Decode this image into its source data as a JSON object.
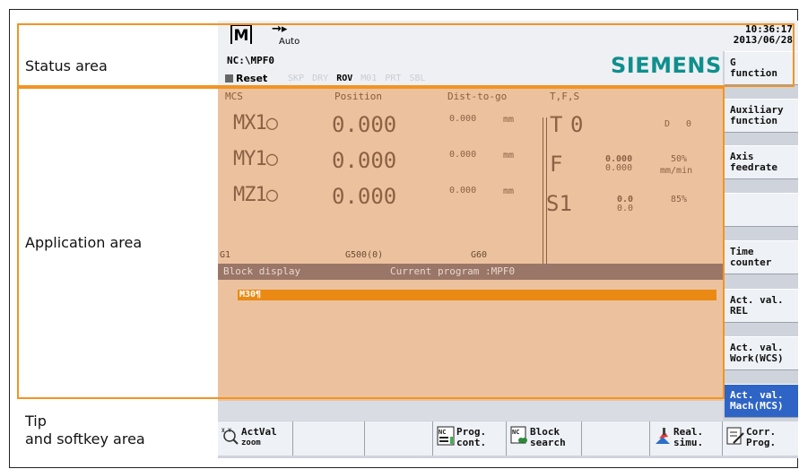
{
  "annotations": {
    "status_area": "Status area",
    "application_area": "Application area",
    "tip_softkey_line1": "Tip",
    "tip_softkey_line2": "and softkey area"
  },
  "status": {
    "mode_letter": "M",
    "mode_arrow": "→▸",
    "mode_text": "Auto",
    "nc_path": "NC:\\MPF0",
    "brand": "SIEMENS",
    "reset_label": "Reset",
    "prog_ctrl_inactive": "SKP DRY",
    "prog_ctrl_active": "ROV",
    "prog_ctrl_inactive2": "M01 PRT SBL",
    "time": "10:36:17",
    "date": "2013/06/28"
  },
  "app": {
    "col_mcs": "MCS",
    "col_position": "Position",
    "col_dist": "Dist-to-go",
    "col_tfs": "T,F,S",
    "axes": [
      {
        "name": "MX1○",
        "position": "0.000",
        "dist": "0.000",
        "unit": "mm"
      },
      {
        "name": "MY1○",
        "position": "0.000",
        "dist": "0.000",
        "unit": "mm"
      },
      {
        "name": "MZ1○",
        "position": "0.000",
        "dist": "0.000",
        "unit": "mm"
      }
    ],
    "tool_letter": "T",
    "tool_value": "0",
    "tool_d": "D",
    "tool_d_value": "0",
    "feed_letter": "F",
    "feed_value": "0.000",
    "feed_value2": "0.000",
    "feed_override": "50%",
    "feed_unit": "mm/min",
    "spindle_letter": "S1",
    "spindle_value": "0.0",
    "spindle_value2": "0.0",
    "spindle_override": "85%",
    "gcode1": "G1",
    "gcode2": "G500(0)",
    "gcode3": "G60",
    "block_display": "Block display",
    "current_program": "Current program :MPF0",
    "block_line": "M30¶"
  },
  "vertical_softkeys": {
    "g_function_1": "G",
    "g_function_2": "function",
    "aux_1": "Auxiliary",
    "aux_2": "function",
    "axis_feed_1": "Axis",
    "axis_feed_2": "feedrate",
    "time_counter_1": "Time",
    "time_counter_2": "counter",
    "act_rel_1": "Act. val.",
    "act_rel_2": "REL",
    "act_wcs_1": "Act. val.",
    "act_wcs_2": "Work(WCS)",
    "act_mcs_1": "Act. val.",
    "act_mcs_2": "Mach(MCS)"
  },
  "horizontal_softkeys": {
    "actval_1": "ActVal",
    "actval_2": "zoom",
    "prog_1": "Prog.",
    "prog_2": "cont.",
    "block_1": "Block",
    "block_2": "search",
    "real_1": "Real.",
    "real_2": "simu.",
    "corr_1": "Corr.",
    "corr_2": "Prog."
  },
  "colors": {
    "annotation_orange": "#f29423",
    "app_background": "#ecc29e",
    "brand_teal": "#0f8f8d",
    "active_softkey": "#2f64c7",
    "block_highlight": "#ea8a14"
  }
}
